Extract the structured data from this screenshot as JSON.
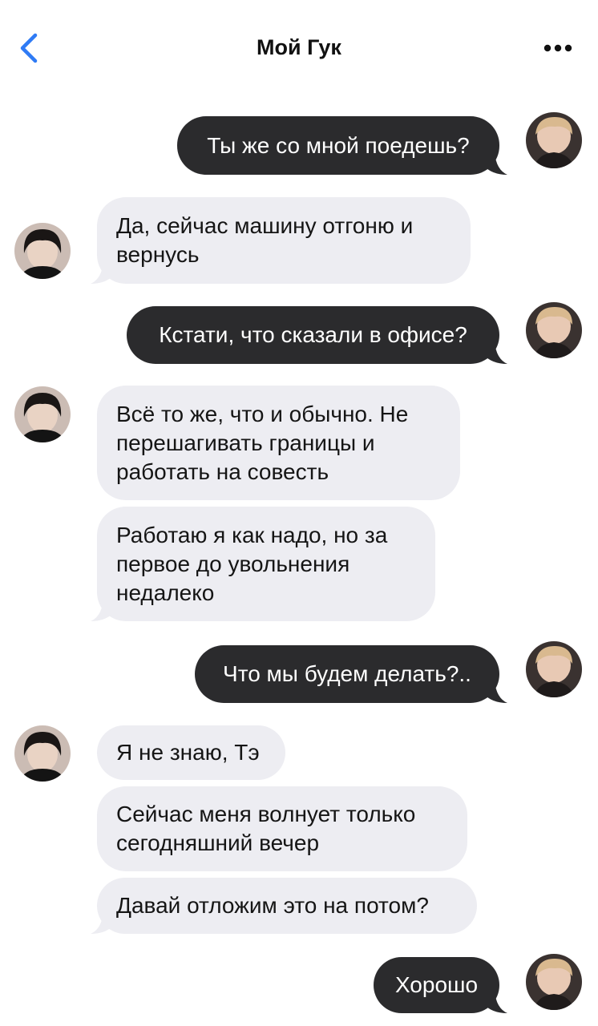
{
  "header": {
    "title": "Мой Гук",
    "back_icon": "chevron-left-icon",
    "more_icon": "ellipsis-icon",
    "accent_color": "#2f7bf5"
  },
  "colors": {
    "outgoing_bubble": "#2b2b2d",
    "incoming_bubble": "#ededf2"
  },
  "messages": [
    {
      "from": "me",
      "text": "Ты же со мной поедешь?"
    },
    {
      "from": "contact",
      "text": "Да, сейчас машину отгоню и\nвернусь"
    },
    {
      "from": "me",
      "text": "Кстати, что сказали в офисе?"
    },
    {
      "from": "contact",
      "text": "Всё то же, что и обычно. Не\nперешагивать границы и\nработать на совесть"
    },
    {
      "from": "contact",
      "text": "Работаю я как надо, но за\nпервое до увольнения\nнедалеко"
    },
    {
      "from": "me",
      "text": "Что мы будем делать?.."
    },
    {
      "from": "contact",
      "text": "Я не знаю, Тэ"
    },
    {
      "from": "contact",
      "text": "Сейчас меня волнует только\nсегодняшний вечер"
    },
    {
      "from": "contact",
      "text": "Давай отложим это на потом?"
    },
    {
      "from": "me",
      "text": "Хорошо"
    }
  ]
}
